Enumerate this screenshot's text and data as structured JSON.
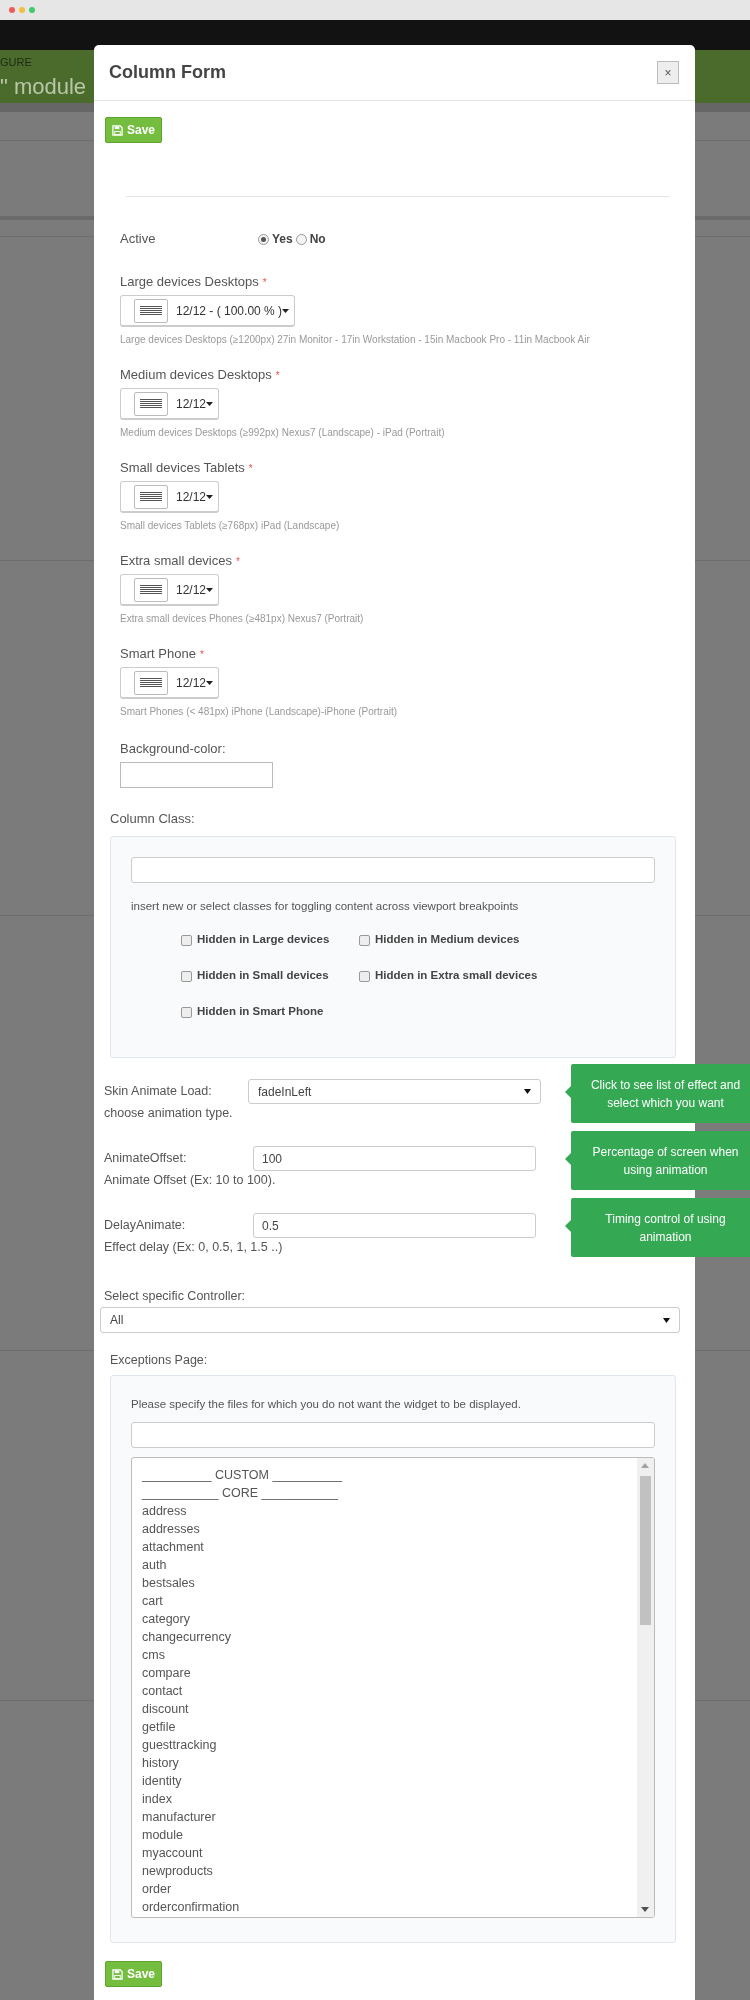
{
  "background_page": {
    "breadcrumb": "GURE",
    "heading": "\" module"
  },
  "modal": {
    "title": "Column Form",
    "close_label": "×"
  },
  "top_button": {
    "label": "Save"
  },
  "active": {
    "label": "Active",
    "options": [
      {
        "label": "Yes",
        "selected": true
      },
      {
        "label": "No",
        "selected": false
      }
    ]
  },
  "width_fields": [
    {
      "label": "Large devices Desktops",
      "required_mark": "*",
      "value": "12/12 - ( 100.00 % )",
      "help": "Large devices Desktops (≥1200px) 27in Monitor - 17in Workstation - 15in Macbook Pro - 11in Macbook Air"
    },
    {
      "label": "Medium devices Desktops",
      "required_mark": "*",
      "value": "12/12",
      "help": "Medium devices Desktops (≥992px) Nexus7 (Landscape) - iPad (Portrait)"
    },
    {
      "label": "Small devices Tablets",
      "required_mark": "*",
      "value": "12/12",
      "help": "Small devices Tablets (≥768px) iPad (Landscape)"
    },
    {
      "label": "Extra small devices",
      "required_mark": "*",
      "value": "12/12",
      "help": "Extra small devices Phones (≥481px) Nexus7 (Portrait)"
    },
    {
      "label": "Smart Phone",
      "required_mark": "*",
      "value": "12/12",
      "help": "Smart Phones (< 481px) iPhone (Landscape)-iPhone (Portrait)"
    }
  ],
  "background_color": {
    "label": "Background-color:"
  },
  "column_class": {
    "label": "Column Class:",
    "hint": "insert new or select classes for toggling content across viewport breakpoints",
    "checkboxes": [
      {
        "label": "Hidden in Large devices",
        "checked": false
      },
      {
        "label": "Hidden in Medium devices",
        "checked": false
      },
      {
        "label": "Hidden in Small devices",
        "checked": false
      },
      {
        "label": "Hidden in Extra small devices",
        "checked": false
      },
      {
        "label": "Hidden in Smart Phone",
        "checked": false
      }
    ]
  },
  "animation_fields": [
    {
      "kind": "select",
      "label": "Skin Animate Load:",
      "value": "fadeInLeft",
      "help": "choose animation type.",
      "tooltip": "Click to see list of effect and select which you want"
    },
    {
      "kind": "input",
      "label": "AnimateOffset:",
      "value": "100",
      "help": "Animate Offset (Ex: 10 to 100).",
      "tooltip": "Percentage of screen when using animation"
    },
    {
      "kind": "input",
      "label": "DelayAnimate:",
      "value": "0.5",
      "help": "Effect delay (Ex: 0, 0.5, 1, 1.5 ..)",
      "tooltip": "Timing control of using animation"
    }
  ],
  "controller": {
    "label": "Select specific Controller:",
    "value": "All"
  },
  "exceptions": {
    "label": "Exceptions Page:",
    "hint": "Please specify the files for which you do not want the widget to be displayed.",
    "items": [
      {
        "label": "__________ CUSTOM __________",
        "selected": false
      },
      {
        "label": "___________ CORE ___________",
        "selected": false
      },
      {
        "label": "address",
        "selected": false
      },
      {
        "label": "addresses",
        "selected": false
      },
      {
        "label": "attachment",
        "selected": false
      },
      {
        "label": "auth",
        "selected": false
      },
      {
        "label": "bestsales",
        "selected": false
      },
      {
        "label": "cart",
        "selected": false
      },
      {
        "label": "category",
        "selected": false
      },
      {
        "label": "changecurrency",
        "selected": false
      },
      {
        "label": "cms",
        "selected": false
      },
      {
        "label": "compare",
        "selected": false
      },
      {
        "label": "contact",
        "selected": false
      },
      {
        "label": "discount",
        "selected": false
      },
      {
        "label": "getfile",
        "selected": false
      },
      {
        "label": "guesttracking",
        "selected": false
      },
      {
        "label": "history",
        "selected": false
      },
      {
        "label": "identity",
        "selected": false
      },
      {
        "label": "index",
        "selected": false
      },
      {
        "label": "manufacturer",
        "selected": false
      },
      {
        "label": "module",
        "selected": false
      },
      {
        "label": "myaccount",
        "selected": false
      },
      {
        "label": "newproducts",
        "selected": false
      },
      {
        "label": "order",
        "selected": false
      },
      {
        "label": "orderconfirmation",
        "selected": false
      }
    ]
  },
  "bottom_button": {
    "label": "Save"
  }
}
